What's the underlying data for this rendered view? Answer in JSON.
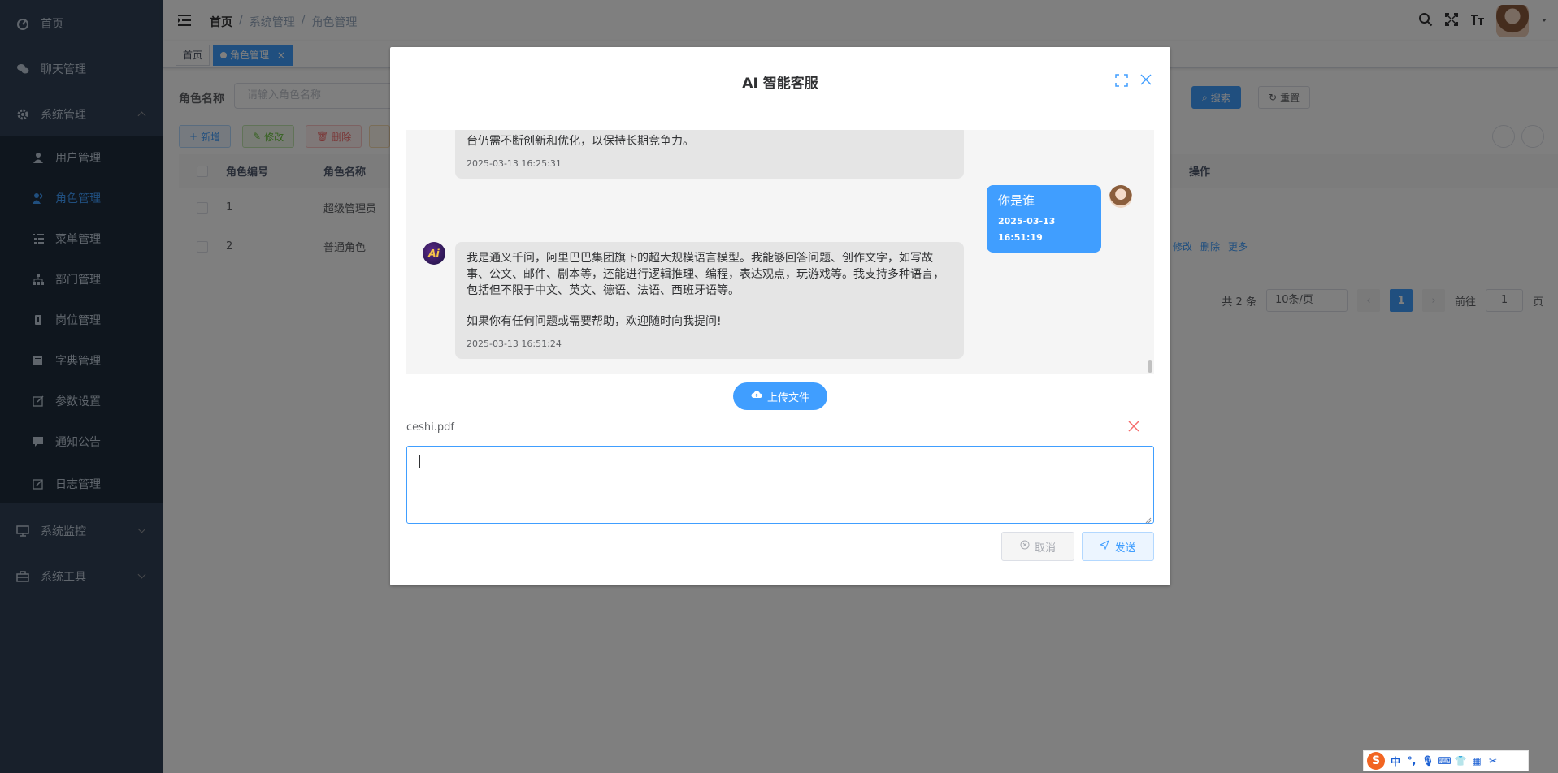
{
  "sidebar": {
    "items": [
      {
        "label": "首页",
        "icon": "dashboard-icon"
      },
      {
        "label": "聊天管理",
        "icon": "chat-icon"
      },
      {
        "label": "系统管理",
        "icon": "gear-icon",
        "expanded": true
      },
      {
        "label": "系统监控",
        "icon": "monitor-icon"
      },
      {
        "label": "系统工具",
        "icon": "toolbox-icon"
      }
    ],
    "subitems": [
      {
        "label": "用户管理",
        "icon": "user-icon"
      },
      {
        "label": "角色管理",
        "icon": "peoples-icon",
        "active": true
      },
      {
        "label": "菜单管理",
        "icon": "tree-table-icon"
      },
      {
        "label": "部门管理",
        "icon": "tree-icon"
      },
      {
        "label": "岗位管理",
        "icon": "post-icon"
      },
      {
        "label": "字典管理",
        "icon": "dict-icon"
      },
      {
        "label": "参数设置",
        "icon": "edit-icon"
      },
      {
        "label": "通知公告",
        "icon": "message-icon"
      },
      {
        "label": "日志管理",
        "icon": "log-icon"
      }
    ]
  },
  "navbar": {
    "breadcrumb": [
      "首页",
      "系统管理",
      "角色管理"
    ],
    "separator": "/"
  },
  "tags": {
    "home": "首页",
    "active": "角色管理",
    "close": "×"
  },
  "query": {
    "label": "角色名称",
    "placeholder": "请输入角色名称",
    "search": "搜索",
    "reset": "重置"
  },
  "toolbar": {
    "add": "新增",
    "edit": "修改",
    "delete": "删除"
  },
  "table": {
    "headers": [
      "角色编号",
      "角色名称",
      "操作"
    ],
    "rows": [
      {
        "id": "1",
        "name": "超级管理员"
      },
      {
        "id": "2",
        "name": "普通角色",
        "actions": [
          "修改",
          "删除",
          "更多"
        ]
      }
    ]
  },
  "pagination": {
    "total": "共 2 条",
    "page_size": "10条/页",
    "current": "1",
    "goto_prefix": "前往",
    "goto_value": "1",
    "goto_suffix": "页"
  },
  "dialog": {
    "title": "AI 智能客服",
    "messages": [
      {
        "role": "ai",
        "text": "台仍需不断创新和优化，以保持长期竞争力。",
        "time": "2025-03-13 16:25:31"
      },
      {
        "role": "user",
        "text": "你是谁",
        "time": "2025-03-13 16:51:19"
      },
      {
        "role": "ai",
        "text": "我是通义千问，阿里巴巴集团旗下的超大规模语言模型。我能够回答问题、创作文字，如写故事、公文、邮件、剧本等，还能进行逻辑推理、编程，表达观点，玩游戏等。我支持多种语言，包括但不限于中文、英文、德语、法语、西班牙语等。",
        "text2": "如果你有任何问题或需要帮助，欢迎随时向我提问!",
        "time": "2025-03-13 16:51:24"
      }
    ],
    "ai_avatar_text": "Ai",
    "upload_label": "上传文件",
    "file_name": "ceshi.pdf",
    "input_value": "",
    "cancel_label": "取消",
    "send_label": "发送"
  },
  "ime": {
    "lang": "中",
    "punct": "°,"
  },
  "colors": {
    "primary": "#409eff",
    "sidebar_bg": "#304156",
    "submenu_bg": "#1f2d3d",
    "danger": "#f56c6c"
  }
}
